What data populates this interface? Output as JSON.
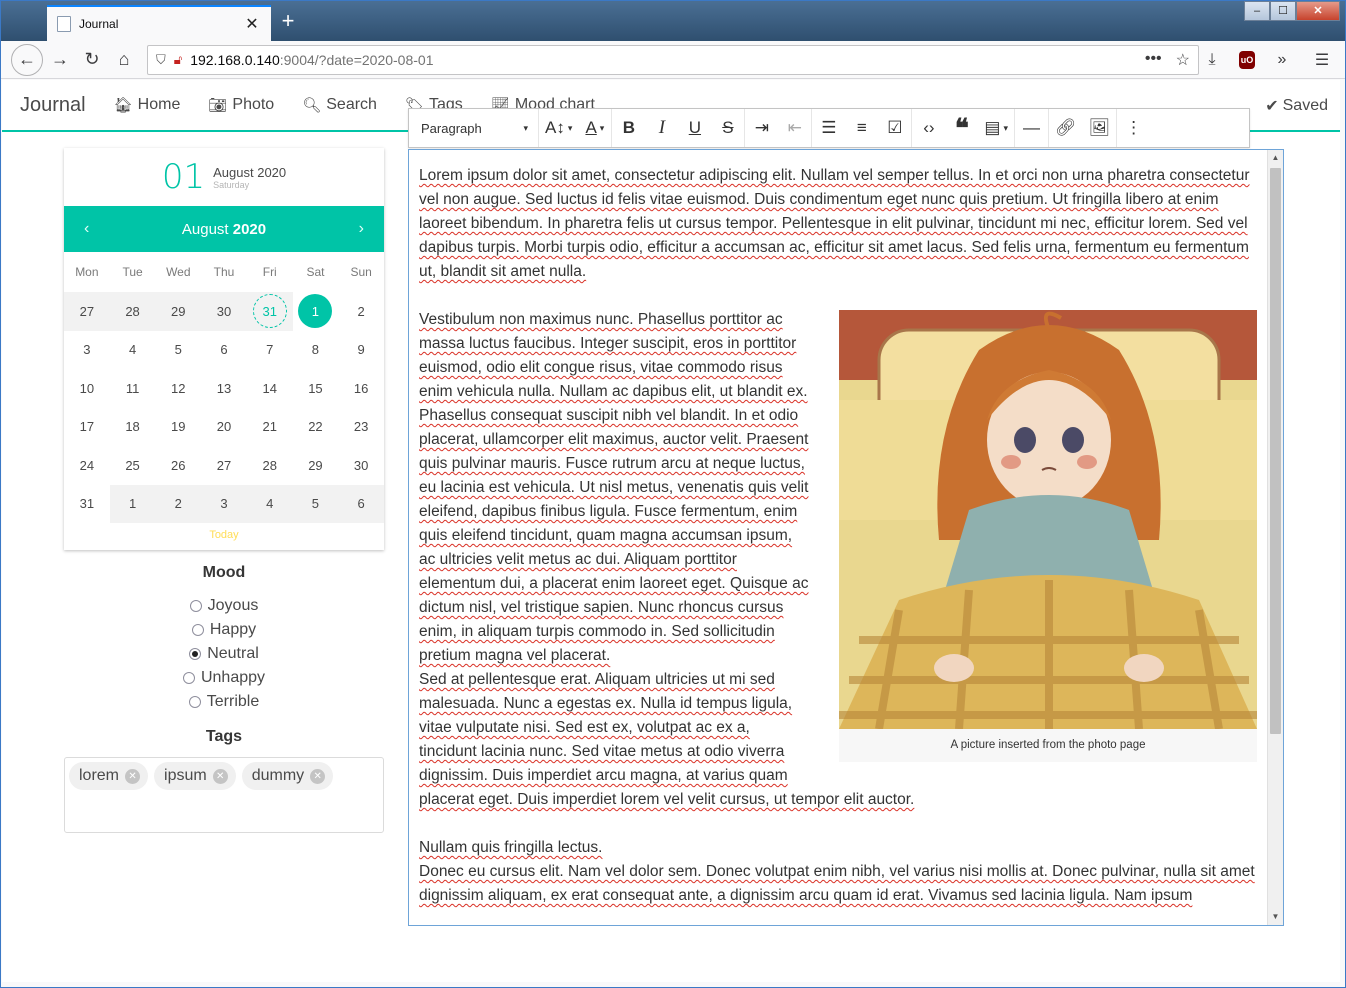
{
  "browser": {
    "tab_title": "Journal",
    "url_host": "192.168.0.140",
    "url_rest": ":9004/?date=2020-08-01",
    "ublock_label": "uO"
  },
  "app": {
    "brand": "Journal",
    "nav": [
      {
        "label": "Home"
      },
      {
        "label": "Photo"
      },
      {
        "label": "Search"
      },
      {
        "label": "Tags"
      },
      {
        "label": "Mood chart"
      }
    ],
    "saved_label": "Saved",
    "accent_color": "#00c4a7"
  },
  "calendar": {
    "day_number": "01",
    "month_year": "August 2020",
    "weekday": "Saturday",
    "nav_month": "August",
    "nav_year": "2020",
    "weekdays": [
      "Mon",
      "Tue",
      "Wed",
      "Thu",
      "Fri",
      "Sat",
      "Sun"
    ],
    "today_label": "Today",
    "days": [
      "27",
      "28",
      "29",
      "30",
      "31",
      "1",
      "2",
      "3",
      "4",
      "5",
      "6",
      "7",
      "8",
      "9",
      "10",
      "11",
      "12",
      "13",
      "14",
      "15",
      "16",
      "17",
      "18",
      "19",
      "20",
      "21",
      "22",
      "23",
      "24",
      "25",
      "26",
      "27",
      "28",
      "29",
      "30",
      "31",
      "1",
      "2",
      "3",
      "4",
      "5",
      "6"
    ]
  },
  "mood": {
    "title": "Mood",
    "options": [
      "Joyous",
      "Happy",
      "Neutral",
      "Unhappy",
      "Terrible"
    ],
    "selected": "Neutral"
  },
  "tags": {
    "title": "Tags",
    "items": [
      "lorem",
      "ipsum",
      "dummy"
    ]
  },
  "toolbar": {
    "heading_select": "Paragraph"
  },
  "editor": {
    "p1": "Lorem ipsum dolor sit amet, consectetur adipiscing elit. Nullam vel semper tellus. In et orci non urna pharetra consectetur vel non augue. Sed luctus id felis vitae euismod. Duis condimentum eget nunc quis pretium. Ut fringilla libero at enim laoreet bibendum. In pharetra felis ut cursus tempor. Pellentesque in elit pulvinar, tincidunt mi nec, efficitur lorem. Sed vel dapibus turpis. Morbi turpis odio, efficitur a accumsan ac, efficitur sit amet lacus. Sed felis urna, fermentum eu fermentum ut, blandit sit amet nulla.",
    "p2": "Vestibulum non maximus nunc. Phasellus porttitor ac massa luctus faucibus. Integer suscipit, eros in porttitor euismod, odio elit congue risus, vitae commodo risus enim vehicula nulla. Nullam ac dapibus elit, ut blandit ex. Phasellus consequat suscipit nibh vel blandit. In et odio placerat, ullamcorper elit maximus, auctor velit. Praesent quis pulvinar mauris. Fusce rutrum arcu at neque luctus, eu lacinia est vehicula. Ut nisl metus, venenatis quis velit eleifend, dapibus finibus ligula. Fusce fermentum, enim quis eleifend tincidunt, quam magna accumsan ipsum, ac ultricies velit metus ac dui. Aliquam porttitor elementum dui, a placerat enim laoreet eget. Quisque ac dictum nisl, vel tristique sapien. Nunc rhoncus cursus enim, in aliquam turpis commodo in. Sed sollicitudin pretium magna vel placerat.",
    "p3": "Sed at pellentesque erat. Aliquam ultricies ut mi sed malesuada. Nunc a egestas ex. Nulla id tempus ligula, vitae vulputate nisi. Sed est ex, volutpat ac ex a, tincidunt lacinia nunc. Sed vitae metus at odio viverra dignissim. Duis imperdiet arcu magna, at varius quam placerat eget. Duis imperdiet lorem vel velit cursus, ut tempor elit auctor.",
    "p4": "Nullam quis fringilla lectus.",
    "p5": "Donec eu cursus elit. Nam vel dolor sem. Donec volutpat enim nibh, vel varius nisi mollis at. Donec pulvinar, nulla sit amet dignissim aliquam, ex erat consequat ante, a dignissim arcu quam id erat. Vivamus sed lacinia ligula. Nam ipsum",
    "figure_caption": "A picture inserted from the photo page"
  }
}
